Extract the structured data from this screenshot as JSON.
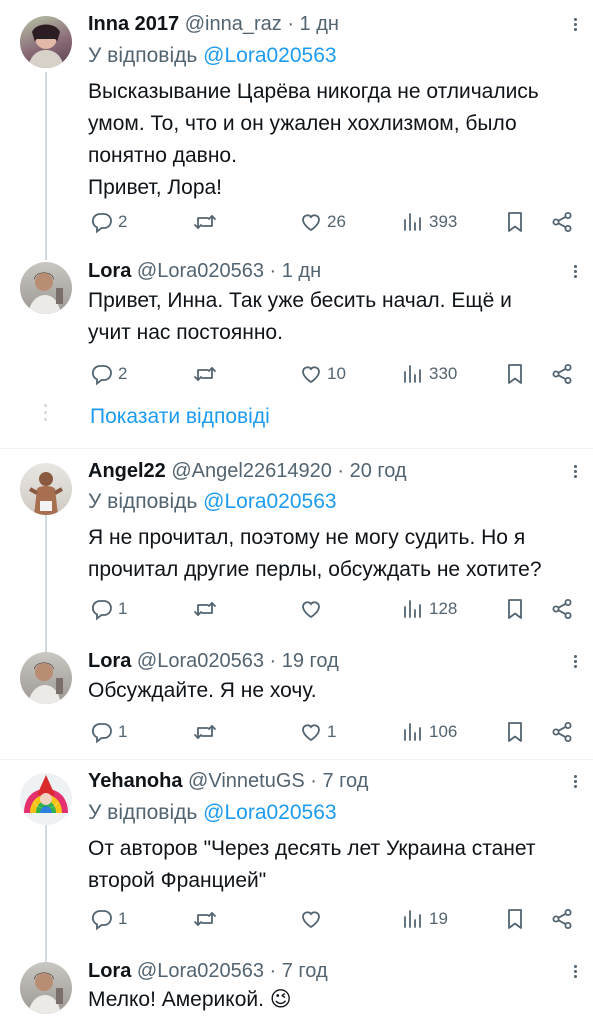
{
  "tweets": [
    {
      "name": "Inna 2017",
      "handle": "@inna_raz · 1 дн",
      "reply_prefix": "У відповідь ",
      "reply_to": "@Lora020563",
      "text": "Высказывание Царёва никогда не отличались\nумом. То, что и он ужален хохлизмом, было\nпонятно давно.\nПривет, Лора!",
      "replies": "2",
      "retweets": "",
      "likes": "26",
      "views": "393"
    },
    {
      "name": "Lora",
      "handle": "@Lora020563 · 1 дн",
      "text": "Привет, Инна. Так уже бесить начал. Ещё и\nучит нас постоянно.",
      "replies": "2",
      "retweets": "",
      "likes": "10",
      "views": "330"
    },
    {
      "name": "Angel22",
      "handle": "@Angel22614920 · 20 год",
      "reply_prefix": "У відповідь ",
      "reply_to": "@Lora020563",
      "text": "Я не прочитал, поэтому не могу судить. Но я\nпрочитал другие перлы, обсуждать не хотите?",
      "replies": "1",
      "retweets": "",
      "likes": "",
      "views": "128"
    },
    {
      "name": "Lora",
      "handle": "@Lora020563 · 19 год",
      "text": "Обсуждайте. Я не хочу.",
      "replies": "1",
      "retweets": "",
      "likes": "1",
      "views": "106"
    },
    {
      "name": "Yehanoha",
      "handle": "@VinnetuGS · 7 год",
      "reply_prefix": "У відповідь ",
      "reply_to": "@Lora020563",
      "text": "От авторов \"Через десять лет Украина станет\nвторой Францией\"",
      "replies": "1",
      "retweets": "",
      "likes": "",
      "views": "19"
    },
    {
      "name": "Lora",
      "handle": "@Lora020563 · 7 год",
      "text": "Мелко! Америкой. 😉"
    }
  ],
  "show_replies": "Показати відповіді",
  "colors": {
    "accent": "#1d9bf0",
    "muted": "#536471",
    "text": "#0f1419"
  },
  "icons": [
    "reply-icon",
    "retweet-icon",
    "like-icon",
    "views-icon",
    "bookmark-icon",
    "share-icon",
    "more-icon"
  ]
}
